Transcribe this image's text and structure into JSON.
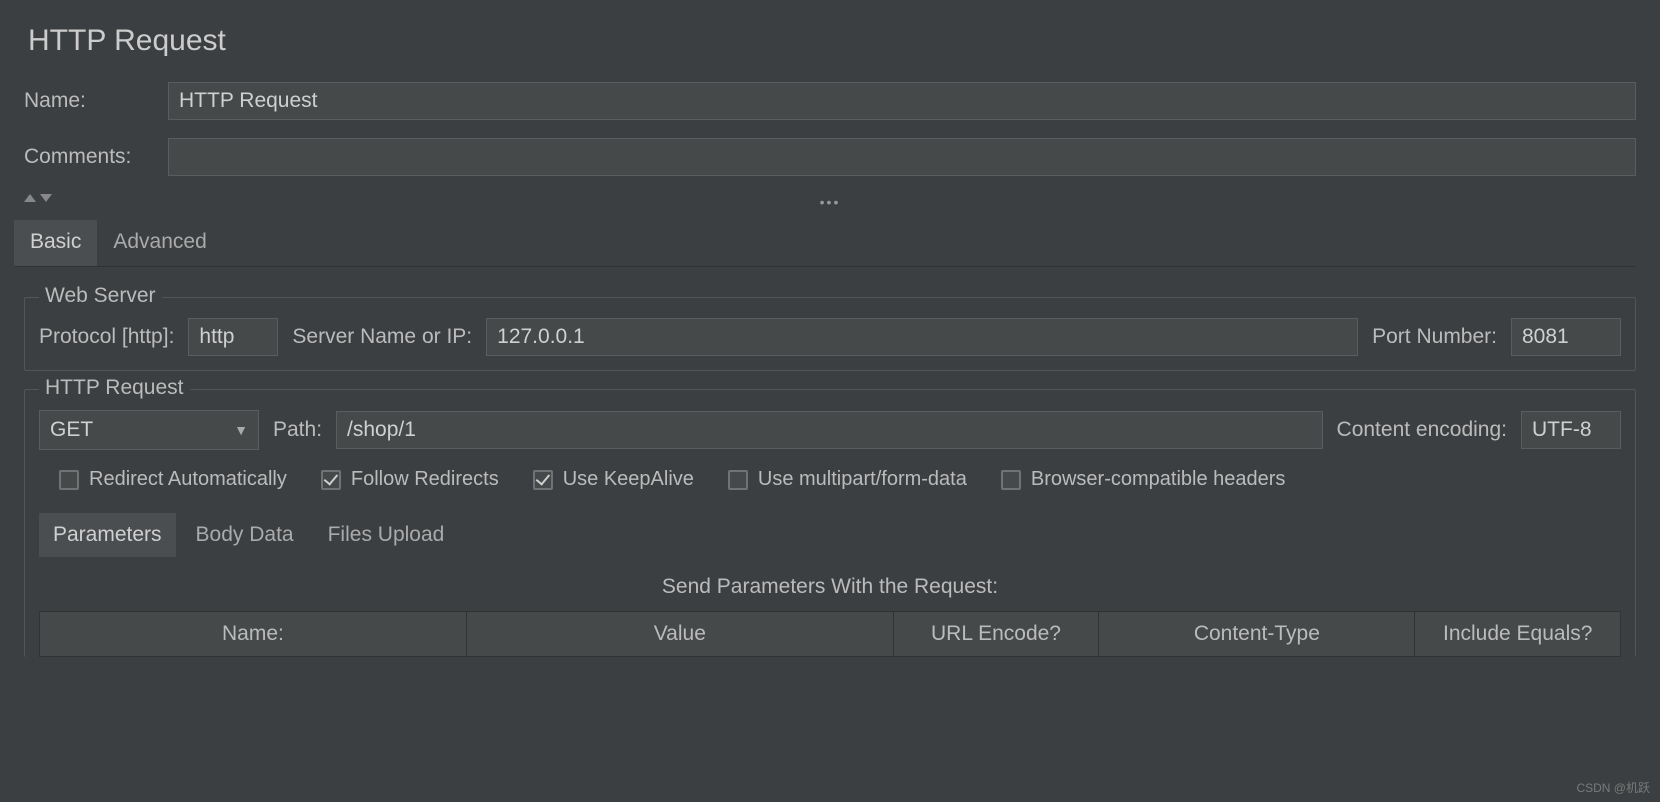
{
  "title": "HTTP Request",
  "form": {
    "name_label": "Name:",
    "name_value": "HTTP Request",
    "comments_label": "Comments:",
    "comments_value": ""
  },
  "tabs": {
    "basic": "Basic",
    "advanced": "Advanced",
    "active": "basic"
  },
  "web_server": {
    "legend": "Web Server",
    "protocol_label": "Protocol [http]:",
    "protocol_value": "http",
    "server_name_label": "Server Name or IP:",
    "server_name_value": "127.0.0.1",
    "port_label": "Port Number:",
    "port_value": "8081"
  },
  "http_request": {
    "legend": "HTTP Request",
    "method_value": "GET",
    "path_label": "Path:",
    "path_value": "/shop/1",
    "encoding_label": "Content encoding:",
    "encoding_value": "UTF-8",
    "checks": {
      "redirect_auto": {
        "label": "Redirect Automatically",
        "checked": false
      },
      "follow_redirects": {
        "label": "Follow Redirects",
        "checked": true
      },
      "keepalive": {
        "label": "Use KeepAlive",
        "checked": true
      },
      "multipart": {
        "label": "Use multipart/form-data",
        "checked": false
      },
      "browser_headers": {
        "label": "Browser-compatible headers",
        "checked": false
      }
    }
  },
  "sub_tabs": {
    "parameters": "Parameters",
    "body_data": "Body Data",
    "files_upload": "Files Upload",
    "active": "parameters"
  },
  "params": {
    "title": "Send Parameters With the Request:",
    "columns": {
      "name": "Name:",
      "value": "Value",
      "url_encode": "URL Encode?",
      "content_type": "Content-Type",
      "include_eq": "Include Equals?"
    }
  },
  "watermark": "CSDN @机跃"
}
